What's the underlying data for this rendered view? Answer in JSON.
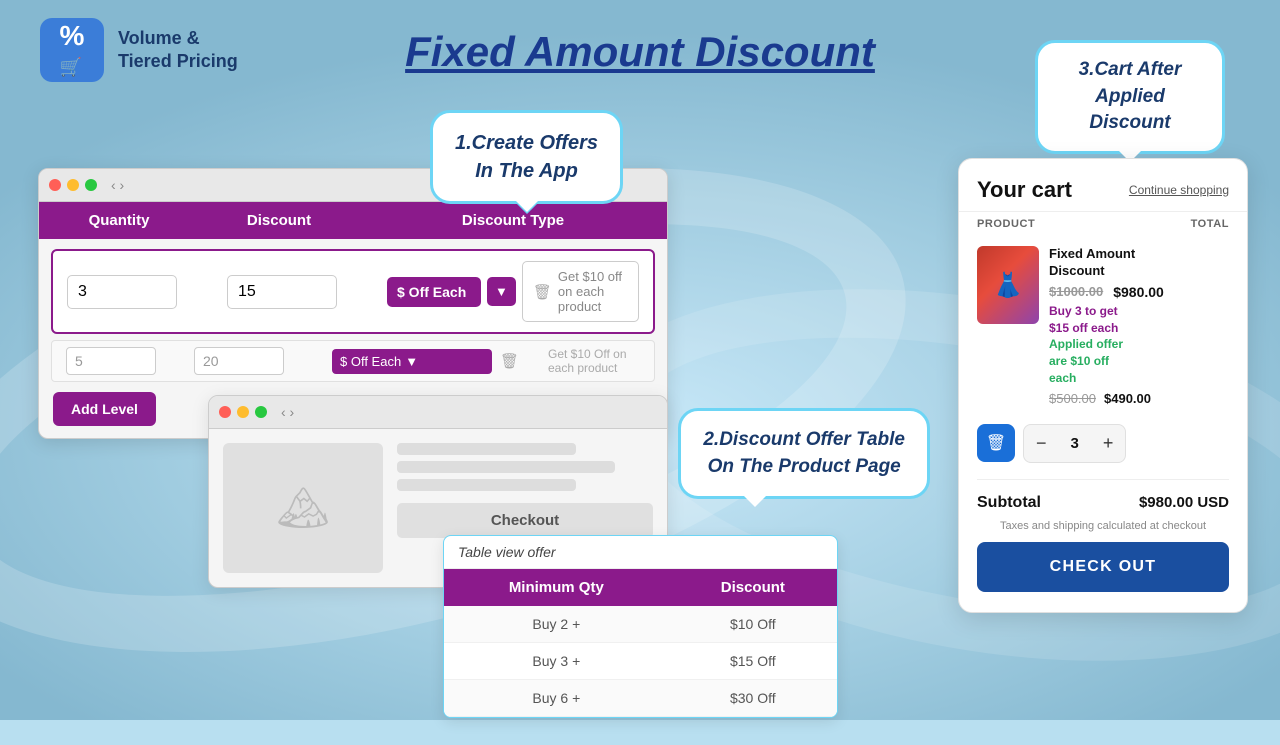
{
  "app": {
    "logo_text": "Volume &\nTiered Pricing",
    "page_title": "Fixed Amount Discount"
  },
  "bubble1": {
    "text": "1.Create Offers\nIn The App"
  },
  "bubble2": {
    "text": "2.Discount Offer Table\nOn The Product Page"
  },
  "bubble3": {
    "text": "3.Cart After\nApplied Discount"
  },
  "config_panel": {
    "columns": [
      "Quantity",
      "Discount",
      "Discount Type"
    ],
    "row1": {
      "quantity": "3",
      "discount": "15",
      "type": "$ Off Each",
      "hint": "Get $10 off on each product"
    },
    "row2": {
      "quantity": "5",
      "discount": "20",
      "type": "$ Off Each",
      "hint": "Get $10 Off on each product"
    },
    "add_level": "Add Level"
  },
  "product_panel": {
    "checkout_btn": "Checkout"
  },
  "offer_table": {
    "title": "Table view offer",
    "headers": [
      "Minimum Qty",
      "Discount"
    ],
    "rows": [
      {
        "qty": "Buy 2 +",
        "discount": "$10 Off"
      },
      {
        "qty": "Buy 3 +",
        "discount": "$15 Off"
      },
      {
        "qty": "Buy 6 +",
        "discount": "$30 Off"
      }
    ]
  },
  "cart": {
    "title": "Your cart",
    "continue": "Continue shopping",
    "col_product": "PRODUCT",
    "col_total": "TOTAL",
    "item": {
      "name": "Fixed Amount\nDiscount",
      "orig_price": "$1000.00",
      "price": "$980.00",
      "offer_text": "Buy 3 to get\n$15 off each",
      "applied_text": "Applied offer\nare $10 off\neach",
      "compare_price": "$500.00",
      "compare_price2": "$490.00"
    },
    "qty": "3",
    "subtotal_label": "Subtotal",
    "subtotal_value": "$980.00 USD",
    "tax_text": "Taxes and shipping calculated at checkout",
    "checkout_btn": "CHECK OUT"
  }
}
